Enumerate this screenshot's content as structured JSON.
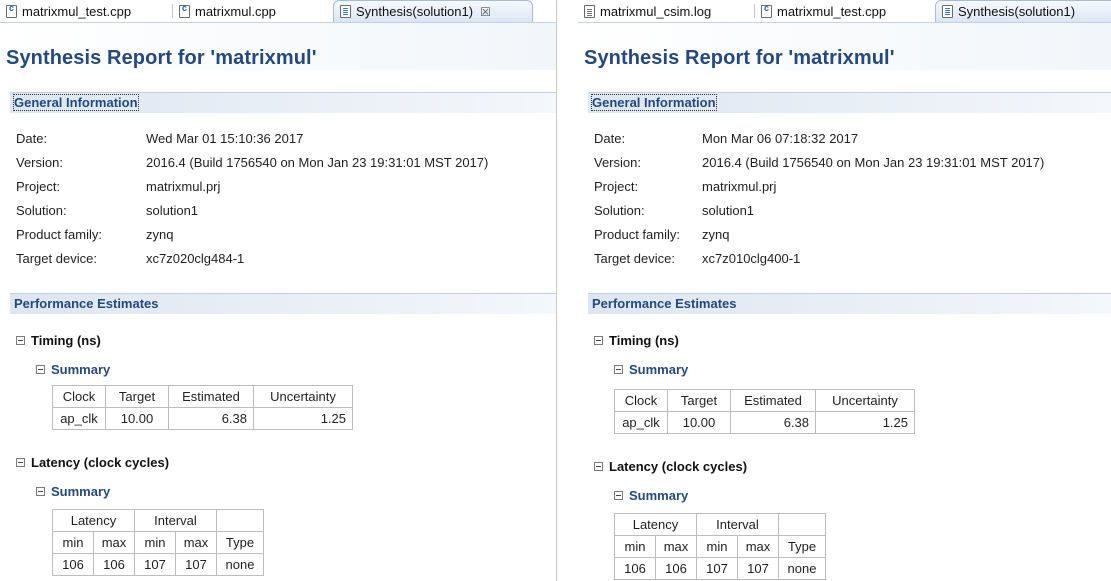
{
  "panels": {
    "left": {
      "tabs": [
        {
          "label": "matrixmul_test.cpp",
          "icon": "cpp-file-icon",
          "active": false
        },
        {
          "label": "matrixmul.cpp",
          "icon": "cpp-file-icon",
          "active": false
        },
        {
          "label": "Synthesis(solution1)",
          "icon": "report-icon",
          "active": true,
          "close": "☒"
        }
      ],
      "title": "Synthesis Report for 'matrixmul'",
      "general_info": {
        "heading": "General Information",
        "rows": [
          {
            "key": "Date:",
            "value": "Wed Mar 01 15:10:36 2017"
          },
          {
            "key": "Version:",
            "value": "2016.4 (Build 1756540 on Mon Jan 23 19:31:01 MST 2017)"
          },
          {
            "key": "Project:",
            "value": "matrixmul.prj"
          },
          {
            "key": "Solution:",
            "value": "solution1"
          },
          {
            "key": "Product family:",
            "value": "zynq"
          },
          {
            "key": "Target device:",
            "value": "xc7z020clg484-1"
          }
        ]
      },
      "performance": {
        "heading": "Performance Estimates",
        "timing_heading": "Timing (ns)",
        "timing_summary": "Summary",
        "timing_table": {
          "headers": [
            "Clock",
            "Target",
            "Estimated",
            "Uncertainty"
          ],
          "row": [
            "ap_clk",
            "10.00",
            "6.38",
            "1.25"
          ]
        },
        "latency_heading": "Latency (clock cycles)",
        "latency_summary": "Summary",
        "latency_table": {
          "group_headers": [
            "Latency",
            "Interval",
            ""
          ],
          "sub_headers": [
            "min",
            "max",
            "min",
            "max",
            "Type"
          ],
          "row": [
            "106",
            "106",
            "107",
            "107",
            "none"
          ]
        }
      }
    },
    "right": {
      "tabs": [
        {
          "label": "matrixmul_csim.log",
          "icon": "log-file-icon",
          "active": false
        },
        {
          "label": "matrixmul_test.cpp",
          "icon": "cpp-file-icon",
          "active": false
        },
        {
          "label": "Synthesis(solution1)",
          "icon": "report-icon",
          "active": true,
          "close": ""
        }
      ],
      "title": "Synthesis Report for 'matrixmul'",
      "general_info": {
        "heading": "General Information",
        "rows": [
          {
            "key": "Date:",
            "value": "Mon Mar 06 07:18:32 2017"
          },
          {
            "key": "Version:",
            "value": "2016.4 (Build 1756540 on Mon Jan 23 19:31:01 MST 2017)"
          },
          {
            "key": "Project:",
            "value": "matrixmul.prj"
          },
          {
            "key": "Solution:",
            "value": "solution1"
          },
          {
            "key": "Product family:",
            "value": "zynq"
          },
          {
            "key": "Target device:",
            "value": "xc7z010clg400-1"
          }
        ]
      },
      "performance": {
        "heading": "Performance Estimates",
        "timing_heading": "Timing (ns)",
        "timing_summary": "Summary",
        "timing_table": {
          "headers": [
            "Clock",
            "Target",
            "Estimated",
            "Uncertainty"
          ],
          "row": [
            "ap_clk",
            "10.00",
            "6.38",
            "1.25"
          ]
        },
        "latency_heading": "Latency (clock cycles)",
        "latency_summary": "Summary",
        "latency_table": {
          "group_headers": [
            "Latency",
            "Interval",
            ""
          ],
          "sub_headers": [
            "min",
            "max",
            "min",
            "max",
            "Type"
          ],
          "row": [
            "106",
            "106",
            "107",
            "107",
            "none"
          ]
        }
      }
    }
  },
  "colors": {
    "title_blue": "#23497e",
    "section_band": "#dde6f1",
    "active_tab": "#dbe6f4",
    "table_border": "#bcbcbc"
  }
}
